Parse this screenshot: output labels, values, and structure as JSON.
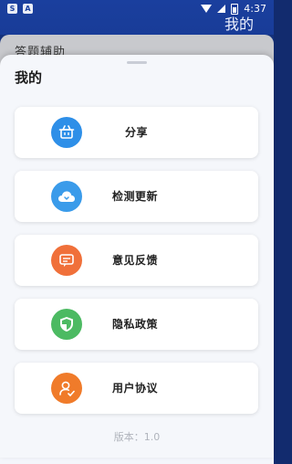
{
  "status_bar": {
    "left_badges": [
      "S",
      "A"
    ],
    "time": "4:37"
  },
  "app_bar": {
    "title": "我的"
  },
  "background_page": {
    "title": "答题辅助"
  },
  "sheet": {
    "title": "我的",
    "items": [
      {
        "label": "分享",
        "icon": "share-basket-icon",
        "color": "#2e8fe8"
      },
      {
        "label": "检测更新",
        "icon": "cloud-icon",
        "color": "#3a9bea"
      },
      {
        "label": "意见反馈",
        "icon": "feedback-icon",
        "color": "#f0703a"
      },
      {
        "label": "隐私政策",
        "icon": "shield-icon",
        "color": "#4cba62"
      },
      {
        "label": "用户协议",
        "icon": "user-agreement-icon",
        "color": "#f07b2a"
      }
    ],
    "version_text": "版本：1.0"
  },
  "colors": {
    "primary": "#1a3f9e",
    "sheet_bg": "#f5f7fb"
  }
}
